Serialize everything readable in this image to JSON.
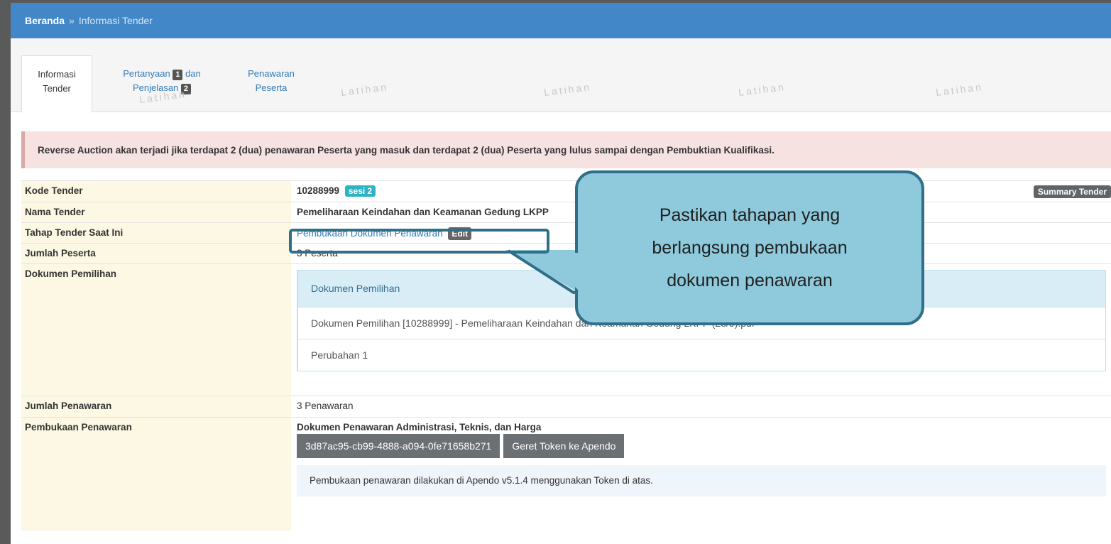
{
  "breadcrumb": {
    "home": "Beranda",
    "separator": "»",
    "current": "Informasi Tender"
  },
  "tabs": {
    "info": {
      "line1": "Informasi",
      "line2": "Tender"
    },
    "questions": {
      "line1": "Pertanyaan",
      "badge1": "1",
      "line1b": "dan",
      "line2": "Penjelasan",
      "badge2": "2"
    },
    "offers": {
      "line1": "Penawaran",
      "line2": "Peserta"
    }
  },
  "watermark": "Latihan",
  "alert": "Reverse Auction akan terjadi jika terdapat 2 (dua) penawaran Peserta yang masuk dan terdapat 2 (dua) Peserta yang lulus sampai dengan Pembuktian Kualifikasi.",
  "rows": {
    "kode": {
      "label": "Kode Tender",
      "value": "10288999",
      "badge": "sesi 2",
      "summary_button": "Summary Tender"
    },
    "nama": {
      "label": "Nama Tender",
      "value": "Pemeliharaan Keindahan dan Keamanan Gedung LKPP"
    },
    "tahap": {
      "label": "Tahap Tender Saat Ini",
      "value": "Pembukaan Dokumen Penawaran",
      "edit": "Edit"
    },
    "peserta": {
      "label": "Jumlah Peserta",
      "value": "3 Peserta"
    },
    "dokumen": {
      "label": "Dokumen Pemilihan",
      "panel_title": "Dokumen Pemilihan",
      "items": [
        "Dokumen Pemilihan [10288999] - Pemeliharaan Keindahan dan Keamanan Gedung LKPP (28/9).pdf",
        "Perubahan 1"
      ]
    },
    "penawaran": {
      "label": "Jumlah Penawaran",
      "value": "3 Penawaran"
    },
    "pembukaan": {
      "label": "Pembukaan Penawaran",
      "title": "Dokumen Penawaran Administrasi, Teknis, dan Harga",
      "token": "3d87ac95-cb99-4888-a094-0fe71658b271",
      "token_button": "Geret Token ke Apendo",
      "note": "Pembukaan penawaran dilakukan di Apendo v5.1.4 menggunakan Token di atas."
    }
  },
  "callout": {
    "line1": "Pastikan tahapan yang",
    "line2": "berlangsung pembukaan",
    "line3": "dokumen penawaran"
  },
  "colors": {
    "topbar": "#4287c7",
    "label_bg": "#fcf8e3",
    "callout_bg": "#8ec9dc",
    "callout_border": "#2f6f88"
  }
}
